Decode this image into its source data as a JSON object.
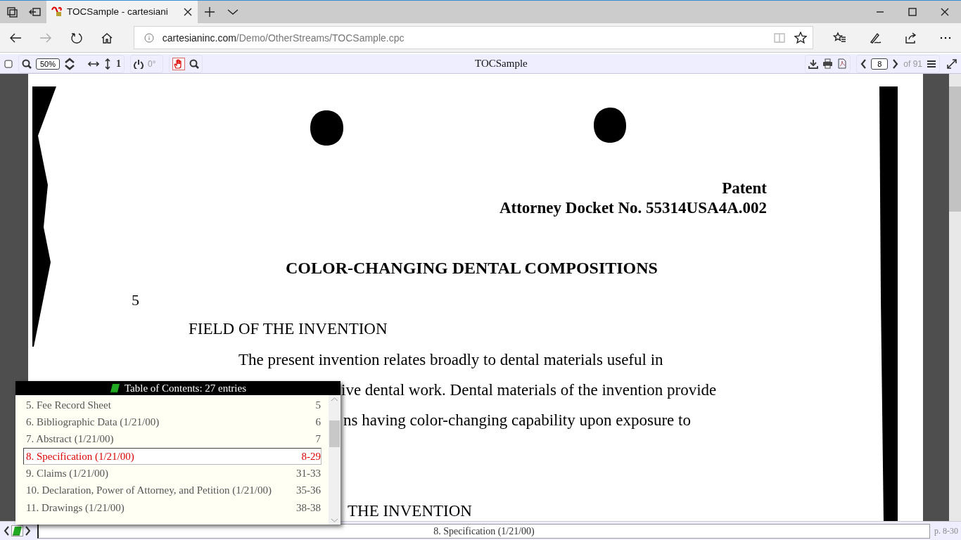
{
  "browser": {
    "tab": {
      "title": "TOCSample - cartesiani",
      "selected": true
    },
    "address": {
      "domain": "cartesianinc.com",
      "path": "/Demo/OtherStreams/TOCSample.cpc"
    }
  },
  "viewer_toolbar": {
    "zoom": "50%",
    "fit_label": "1",
    "rotation": "0°",
    "hand_tool_on": true,
    "title": "TOCSample",
    "page": "8",
    "page_count": "of 91"
  },
  "document": {
    "header": [
      "Patent",
      "Attorney Docket No. 55314USA4A.002"
    ],
    "title": "COLOR-CHANGING DENTAL COMPOSITIONS",
    "line_number": "5",
    "heading": "FIELD OF THE INVENTION",
    "lines": [
      "The present invention relates broadly to dental materials useful in",
      "ive dental work. Dental materials of the invention provide",
      "ns having color-changing capability upon exposure to"
    ],
    "heading_2": "THE INVENTION"
  },
  "toc": {
    "title": "Table of Contents: 27 entries",
    "entries": [
      {
        "label": "5. Fee Record Sheet",
        "pages": "5",
        "selected": false
      },
      {
        "label": "6. Bibliographic Data (1/21/00)",
        "pages": "6",
        "selected": false
      },
      {
        "label": "7. Abstract (1/21/00)",
        "pages": "7",
        "selected": false
      },
      {
        "label": "8. Specification (1/21/00)",
        "pages": "8-29",
        "selected": true
      },
      {
        "label": "9. Claims (1/21/00)",
        "pages": "31-33",
        "selected": false
      },
      {
        "label": "10. Declaration, Power of Attorney, and Petition (1/21/00)",
        "pages": "35-36",
        "selected": false
      },
      {
        "label": "11. Drawings (1/21/00)",
        "pages": "38-38",
        "selected": false
      }
    ]
  },
  "status_bar": {
    "location": "8. Specification (1/21/00)",
    "page_range": "p. 8-30"
  }
}
